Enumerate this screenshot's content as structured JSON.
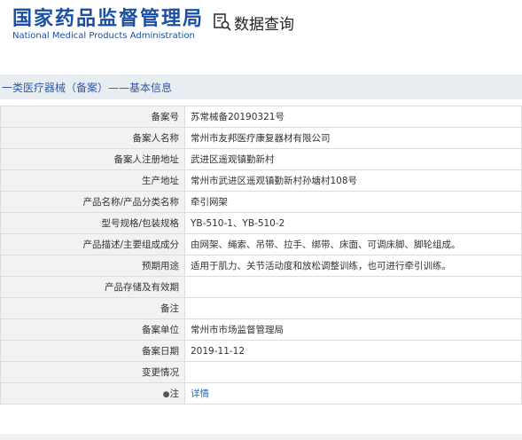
{
  "header": {
    "logo_cn": "国家药品监督管理局",
    "logo_en": "National Medical Products Administration",
    "search_label": "数据查询"
  },
  "section": {
    "title": "一类医疗器械（备案）——基本信息"
  },
  "rows": [
    {
      "label": "备案号",
      "value": "苏常械备20190321号"
    },
    {
      "label": "备案人名称",
      "value": "常州市友邦医疗康复器材有限公司"
    },
    {
      "label": "备案人注册地址",
      "value": "武进区遥观镇勤新村"
    },
    {
      "label": "生产地址",
      "value": "常州市武进区遥观镇勤新村孙塘村108号"
    },
    {
      "label": "产品名称/产品分类名称",
      "value": "牵引网架"
    },
    {
      "label": "型号规格/包装规格",
      "value": "YB-510-1、YB-510-2"
    },
    {
      "label": "产品描述/主要组成成分",
      "value": "由网架、绳索、吊带、拉手、绑带、床面、可调床脚、脚轮组成。"
    },
    {
      "label": "预期用途",
      "value": "适用于肌力、关节活动度和放松调整训练，也可进行牵引训练。"
    },
    {
      "label": "产品存储及有效期",
      "value": ""
    },
    {
      "label": "备注",
      "value": ""
    },
    {
      "label": "备案单位",
      "value": "常州市市场监督管理局"
    },
    {
      "label": "备案日期",
      "value": "2019-11-12"
    },
    {
      "label": "变更情况",
      "value": ""
    },
    {
      "label": "注",
      "value": "详情"
    }
  ],
  "colors": {
    "brand_blue": "#1a4fa3",
    "link_blue": "#2a6db5",
    "label_bg": "#f2f2f2",
    "section_bg": "#e8edf2"
  },
  "icons": {
    "search": "document-search-icon",
    "note": "pin-icon"
  }
}
